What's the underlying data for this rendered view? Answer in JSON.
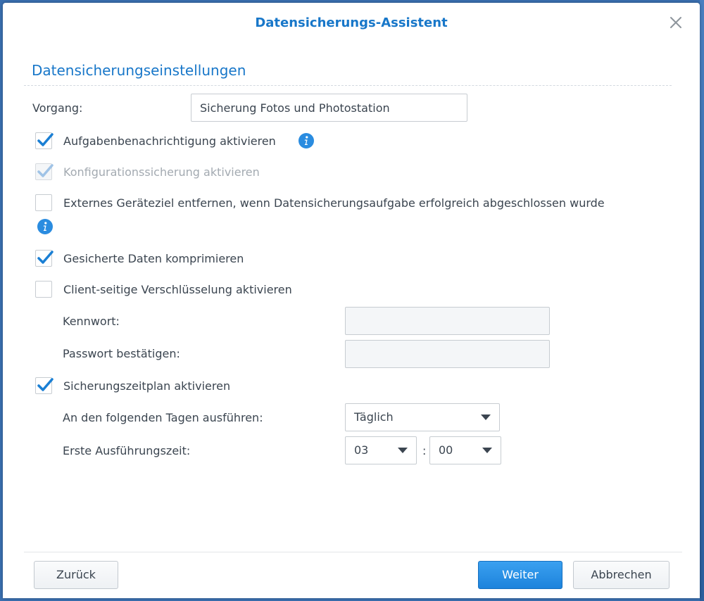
{
  "dialog": {
    "title": "Datensicherungs-Assistent"
  },
  "section": {
    "title": "Datensicherungseinstellungen"
  },
  "task": {
    "label": "Vorgang:",
    "value": "Sicherung Fotos und Photostation"
  },
  "options": {
    "notification": {
      "label": "Aufgabenbenachrichtigung aktivieren",
      "checked": true
    },
    "config_backup": {
      "label": "Konfigurationssicherung aktivieren",
      "checked": true,
      "disabled": true
    },
    "remove_external": {
      "label": "Externes Geräteziel entfernen, wenn Datensicherungsaufgabe erfolgreich abgeschlossen wurde",
      "checked": false
    },
    "compress": {
      "label": "Gesicherte Daten komprimieren",
      "checked": true
    },
    "encryption": {
      "label": "Client-seitige Verschlüsselung aktivieren",
      "checked": false
    },
    "schedule": {
      "label": "Sicherungszeitplan aktivieren",
      "checked": true
    }
  },
  "encryption_fields": {
    "password_label": "Kennwort:",
    "confirm_label": "Passwort bestätigen:"
  },
  "schedule_fields": {
    "days_label": "An den folgenden Tagen ausführen:",
    "days_value": "Täglich",
    "time_label": "Erste Ausführungszeit:",
    "hour_value": "03",
    "minute_value": "00",
    "separator": ":"
  },
  "footer": {
    "back_label": "Zurück",
    "next_label": "Weiter",
    "cancel_label": "Abbrechen"
  },
  "colors": {
    "accent": "#1877c9",
    "primary_button": "#1d83dc",
    "check": "#1a7fd4",
    "check_disabled": "#9fc3e6"
  },
  "icons": [
    "close-icon",
    "info-icon",
    "check-icon",
    "dropdown-arrow-icon"
  ]
}
